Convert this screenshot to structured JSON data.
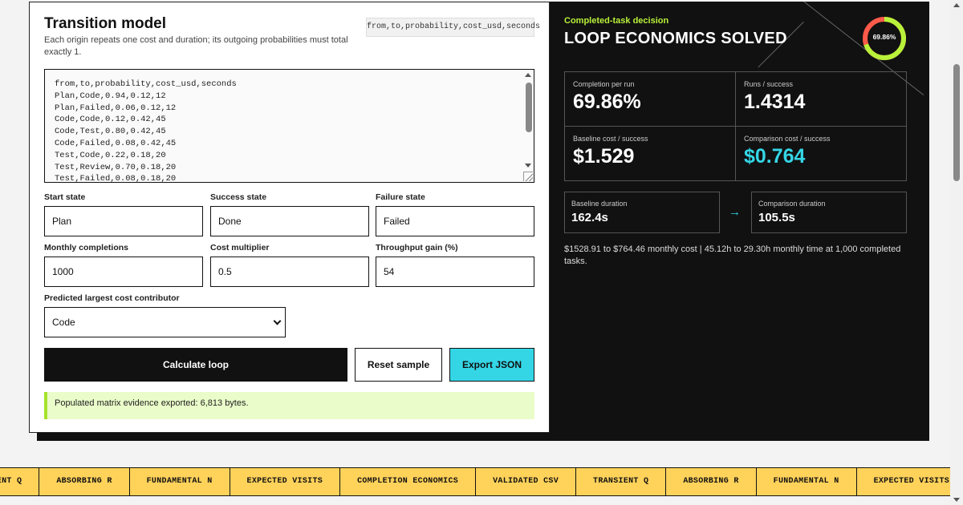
{
  "left": {
    "title": "Transition model",
    "subtitle": "Each origin repeats one cost and duration; its outgoing probabilities must total exactly 1.",
    "header_chip": "from,to,probability,cost_usd,seconds",
    "csv": "from,to,probability,cost_usd,seconds\nPlan,Code,0.94,0.12,12\nPlan,Failed,0.06,0.12,12\nCode,Code,0.12,0.42,45\nCode,Test,0.80,0.42,45\nCode,Failed,0.08,0.42,45\nTest,Code,0.22,0.18,20\nTest,Review,0.70,0.18,20\nTest,Failed,0.08,0.18,20",
    "fields": {
      "start_label": "Start state",
      "start_value": "Plan",
      "success_label": "Success state",
      "success_value": "Done",
      "failure_label": "Failure state",
      "failure_value": "Failed",
      "monthly_label": "Monthly completions",
      "monthly_value": "1000",
      "multiplier_label": "Cost multiplier",
      "multiplier_value": "0.5",
      "throughput_label": "Throughput gain (%)",
      "throughput_value": "54",
      "contributor_label": "Predicted largest cost contributor",
      "contributor_value": "Code"
    },
    "buttons": {
      "calculate": "Calculate loop",
      "reset": "Reset sample",
      "export": "Export JSON"
    },
    "notice": "Populated matrix evidence exported: 6,813 bytes."
  },
  "right": {
    "kicker": "Completed-task decision",
    "headline": "LOOP ECONOMICS SOLVED",
    "donut_label": "69.86%",
    "donut_fraction": 0.6986,
    "metrics": {
      "completion_label": "Completion per run",
      "completion_value": "69.86%",
      "runs_label": "Runs / success",
      "runs_value": "1.4314",
      "baseline_cost_label": "Baseline cost / success",
      "baseline_cost_value": "$1.529",
      "comparison_cost_label": "Comparison cost / success",
      "comparison_cost_value": "$0.764"
    },
    "durations": {
      "baseline_label": "Baseline duration",
      "baseline_value": "162.4s",
      "arrow": "→",
      "comparison_label": "Comparison duration",
      "comparison_value": "105.5s"
    },
    "summary": "$1528.91 to $764.46 monthly cost | 45.12h to 29.30h monthly time at 1,000 completed tasks."
  },
  "ticker": [
    "TRANSIENT Q",
    "ABSORBING R",
    "FUNDAMENTAL N",
    "EXPECTED VISITS",
    "COMPLETION ECONOMICS",
    "VALIDATED CSV",
    "TRANSIENT Q",
    "ABSORBING R",
    "FUNDAMENTAL N",
    "EXPECTED VISITS"
  ],
  "colors": {
    "accent_cyan": "#34d6e6",
    "accent_lime": "#b9f23a",
    "donut_red": "#ff5a4a",
    "ticker_bg": "#ffd25a",
    "notice_bg": "#eafcc9"
  }
}
